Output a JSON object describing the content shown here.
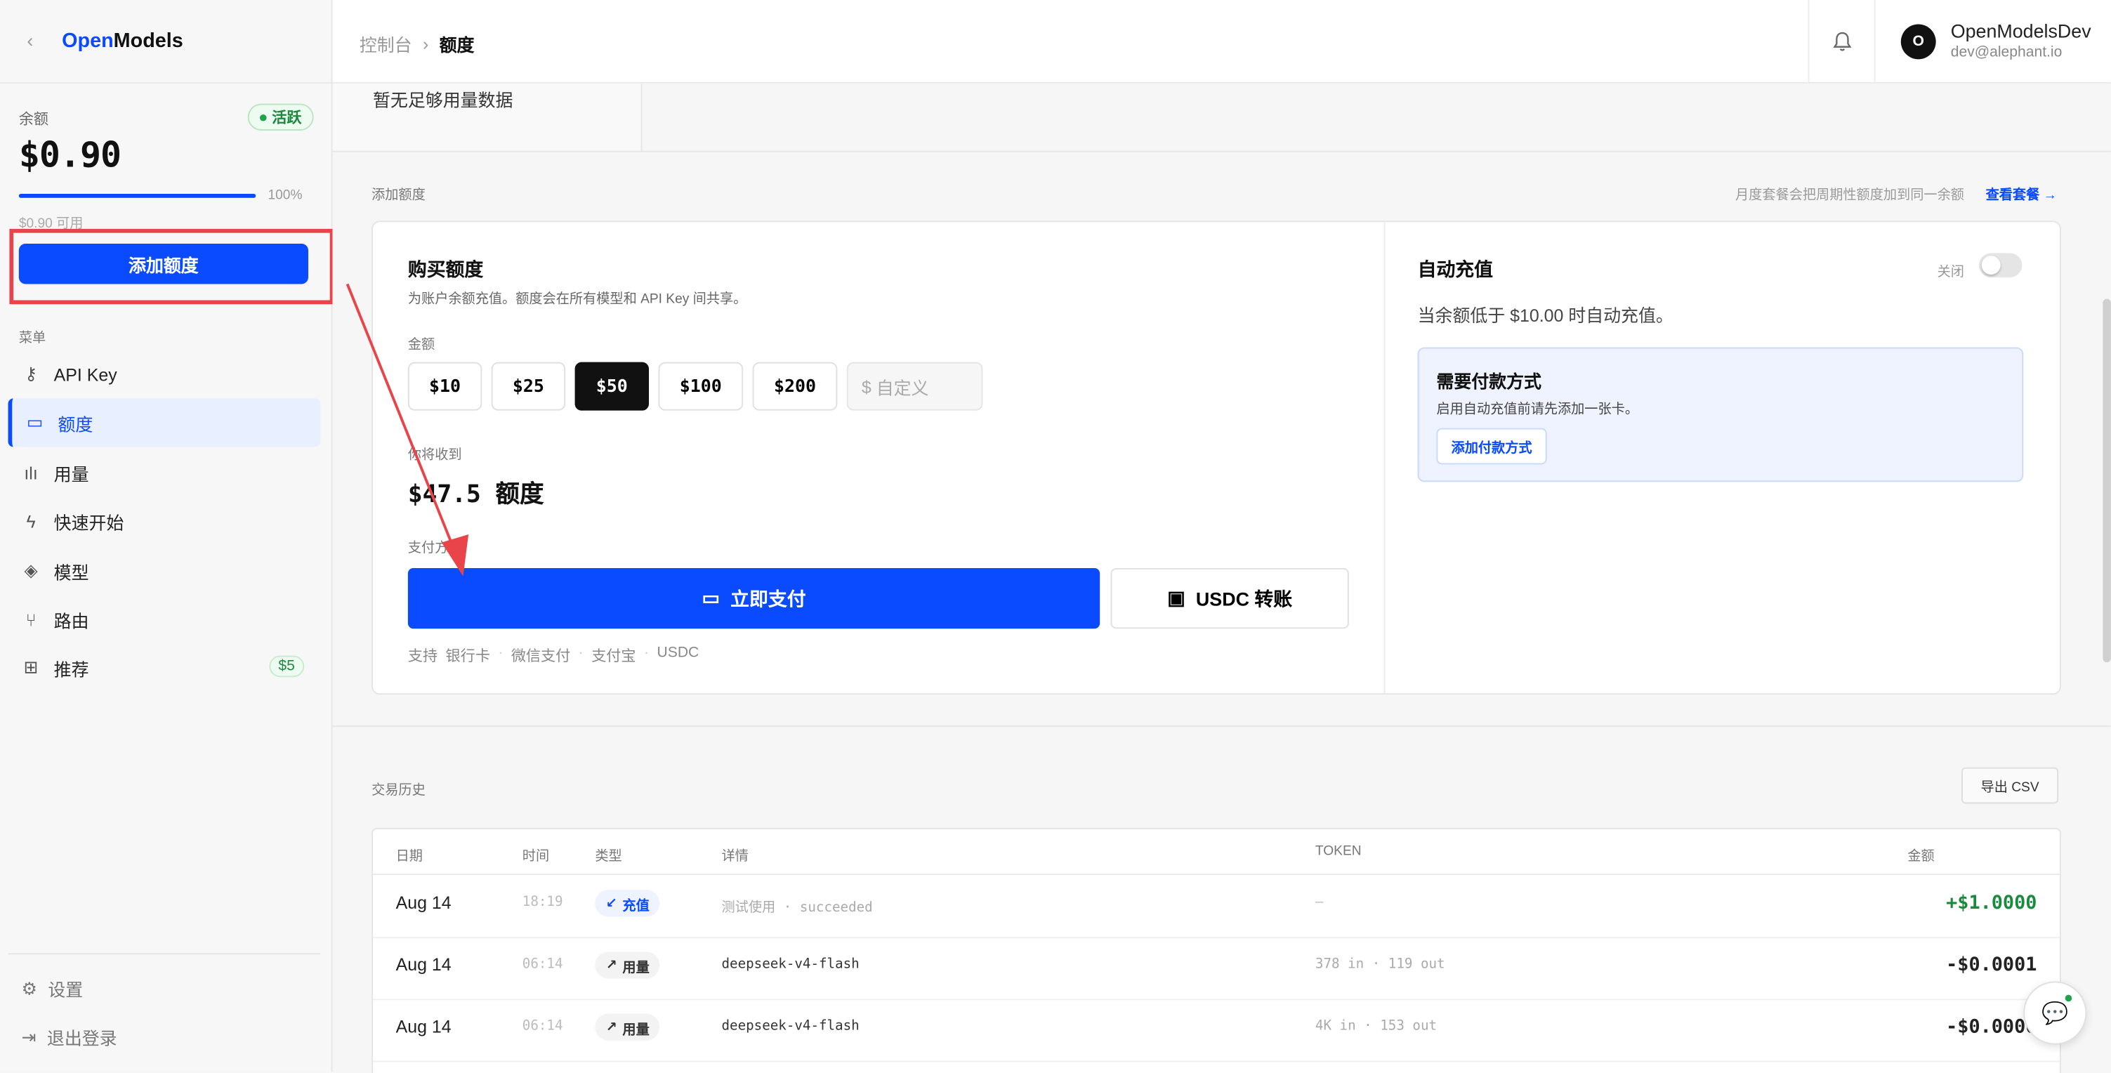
{
  "brand": {
    "name_part1": "Open",
    "name_part2": "Models",
    "back_icon": "chevron-left-icon"
  },
  "balance": {
    "label": "余额",
    "status": "活跃",
    "value": "$0.90",
    "progress_fraction": 1.0,
    "percent_text": "100%",
    "available": "$0.90 可用",
    "add_button": "添加额度"
  },
  "menu": {
    "label": "菜单",
    "items": [
      {
        "label": "API Key",
        "icon": "key-icon"
      },
      {
        "label": "额度",
        "icon": "credit-card-icon",
        "active": true
      },
      {
        "label": "用量",
        "icon": "bar-chart-icon"
      },
      {
        "label": "快速开始",
        "icon": "lightning-icon"
      },
      {
        "label": "模型",
        "icon": "layers-icon"
      },
      {
        "label": "路由",
        "icon": "git-branch-icon"
      },
      {
        "label": "推荐",
        "icon": "gift-icon",
        "badge": "$5"
      }
    ],
    "bottom": [
      {
        "label": "设置",
        "icon": "gear-icon"
      },
      {
        "label": "退出登录",
        "icon": "logout-icon"
      }
    ]
  },
  "header": {
    "breadcrumb": [
      "控制台",
      "额度"
    ],
    "user": {
      "initial": "O",
      "name": "OpenModelsDev",
      "email": "dev@alephant.io"
    }
  },
  "main": {
    "no_data": "暂无足够用量数据",
    "add_credit_title": "添加额度",
    "plan_note": "月度套餐会把周期性额度加到同一余额",
    "plan_link": "查看套餐 →",
    "buy": {
      "title": "购买额度",
      "desc": "为账户余额充值。额度会在所有模型和 API Key 间共享。",
      "amount_label": "金额",
      "amounts": [
        "$10",
        "$25",
        "$50",
        "$100",
        "$200"
      ],
      "selected_amount": "$50",
      "custom_placeholder": "自定义",
      "custom_prefix": "$",
      "receive_label": "你将收到",
      "receive_value": "$47.5 额度",
      "payment_label": "支付方式",
      "pay_now": "立即支付",
      "usdc_transfer": "USDC 转账",
      "support_prefix": "支持",
      "support_methods": [
        "银行卡",
        "微信支付",
        "支付宝",
        "USDC"
      ]
    },
    "auto": {
      "title": "自动充值",
      "toggle_label": "关闭",
      "desc": "当余额低于 $10.00 时自动充值。",
      "need_title": "需要付款方式",
      "need_desc": "启用自动充值前请先添加一张卡。",
      "need_button": "添加付款方式"
    },
    "history": {
      "title": "交易历史",
      "export": "导出 CSV",
      "columns": [
        "日期",
        "时间",
        "类型",
        "详情",
        "TOKEN",
        "金额"
      ],
      "rows": [
        {
          "date": "Aug 14",
          "time": "18:19",
          "type": "充值",
          "type_kind": "topup",
          "detail": "测试使用 · succeeded",
          "token": "—",
          "amount": "+$1.0000"
        },
        {
          "date": "Aug 14",
          "time": "06:14",
          "type": "用量",
          "type_kind": "usage",
          "detail": "deepseek-v4-flash",
          "token": "378 in · 119 out",
          "amount": "-$0.0001"
        },
        {
          "date": "Aug 14",
          "time": "06:14",
          "type": "用量",
          "type_kind": "usage",
          "detail": "deepseek-v4-flash",
          "token": "4K in · 153 out",
          "amount": "-$0.0000"
        }
      ]
    }
  },
  "colors": {
    "accent": "#0a4bff",
    "highlight": "#e8444a",
    "success": "#1b8a3d"
  }
}
